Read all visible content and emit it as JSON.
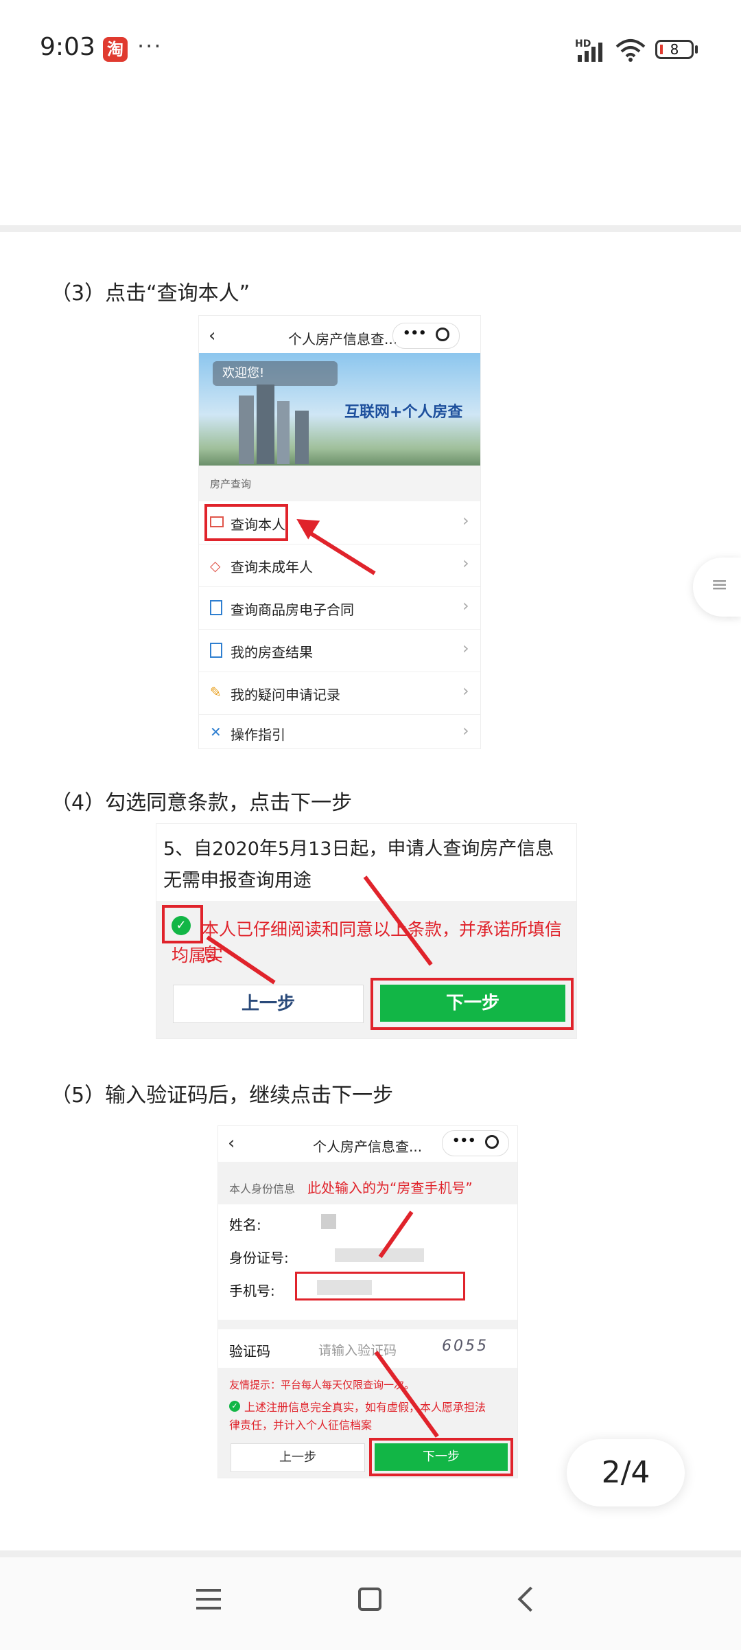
{
  "status_bar": {
    "time": "9:03",
    "app_badge": "淘",
    "dots": "···",
    "network": "HD",
    "battery_level": "8"
  },
  "steps": {
    "step3": "（3）点击“查询本人”",
    "step4": "（4）勾选同意条款，点击下一步",
    "step5": "（5）输入验证码后，继续点击下一步"
  },
  "screen1": {
    "title": "个人房产信息查...",
    "welcome": "欢迎您!",
    "banner_text": "互联网+个人房查",
    "section": "房产查询",
    "items": [
      {
        "label": "查询本人",
        "icon": "id-card-icon"
      },
      {
        "label": "查询未成年人",
        "icon": "graduation-cap-icon"
      },
      {
        "label": "查询商品房电子合同",
        "icon": "contract-icon"
      },
      {
        "label": "我的房查结果",
        "icon": "result-doc-icon"
      },
      {
        "label": "我的疑问申请记录",
        "icon": "edit-icon"
      },
      {
        "label": "操作指引",
        "icon": "tools-icon"
      }
    ]
  },
  "screen2": {
    "line1": "5、自2020年5月13日起，申请人查询房产信息",
    "line2": "无需申报查询用途",
    "agree_line1": "本人已仔细阅读和同意以上条款，并承诺所填信息",
    "agree_line2": "均属实",
    "prev": "上一步",
    "next": "下一步"
  },
  "screen3": {
    "title": "个人房产信息查...",
    "section": "本人身份信息",
    "annotation": "此处输入的为“房查手机号”",
    "name_label": "姓名:",
    "id_label": "身份证号:",
    "phone_label": "手机号:",
    "captcha_label": "验证码",
    "captcha_placeholder": "请输入验证码",
    "captcha_value": "6055",
    "tip": "友情提示：平台每人每天仅限查询一次。",
    "declaration_line1": "上述注册信息完全真实，如有虚假，本人愿承担法",
    "declaration_line2": "律责任，并计入个人征信档案",
    "prev": "上一步",
    "next": "下一步"
  },
  "pager": "2/4"
}
